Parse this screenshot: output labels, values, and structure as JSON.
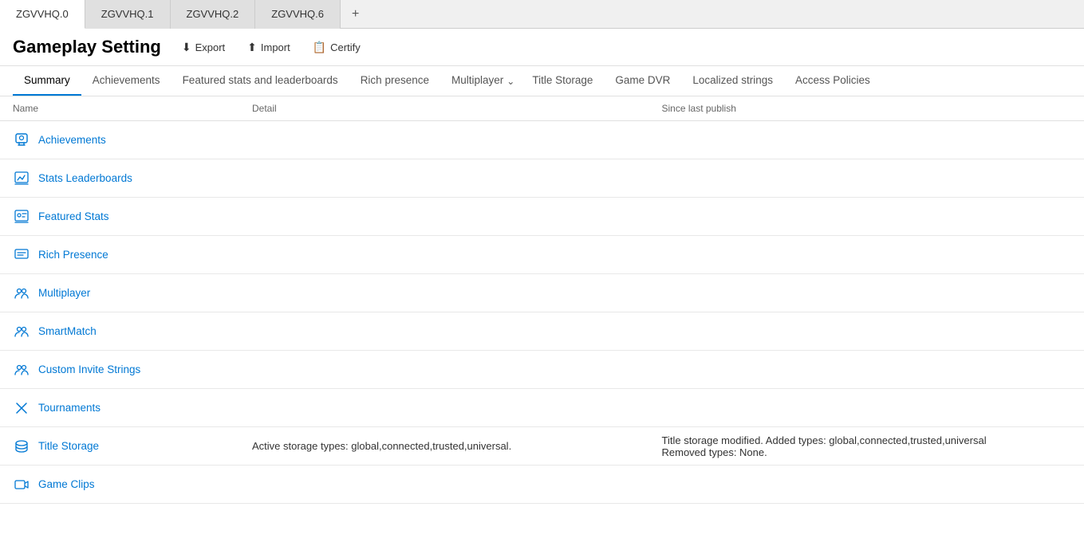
{
  "tabs": [
    {
      "id": "zgvvhq0",
      "label": "ZGVVHQ.0",
      "active": true
    },
    {
      "id": "zgvvhq1",
      "label": "ZGVVHQ.1",
      "active": false
    },
    {
      "id": "zgvvhq2",
      "label": "ZGVVHQ.2",
      "active": false
    },
    {
      "id": "zgvvhq6",
      "label": "ZGVVHQ.6",
      "active": false
    }
  ],
  "tab_add_label": "+",
  "page_title": "Gameplay Setting",
  "actions": [
    {
      "id": "export",
      "icon": "⬇",
      "label": "Export"
    },
    {
      "id": "import",
      "icon": "⬆",
      "label": "Import"
    },
    {
      "id": "certify",
      "icon": "📋",
      "label": "Certify"
    }
  ],
  "nav_tabs": [
    {
      "id": "summary",
      "label": "Summary",
      "active": true
    },
    {
      "id": "achievements",
      "label": "Achievements",
      "active": false
    },
    {
      "id": "featured-stats",
      "label": "Featured stats and leaderboards",
      "active": false
    },
    {
      "id": "rich-presence",
      "label": "Rich presence",
      "active": false
    },
    {
      "id": "multiplayer",
      "label": "Multiplayer",
      "active": false,
      "has_chevron": true
    },
    {
      "id": "title-storage",
      "label": "Title Storage",
      "active": false
    },
    {
      "id": "game-dvr",
      "label": "Game DVR",
      "active": false
    },
    {
      "id": "localized-strings",
      "label": "Localized strings",
      "active": false
    },
    {
      "id": "access-policies",
      "label": "Access Policies",
      "active": false
    }
  ],
  "table": {
    "columns": [
      {
        "id": "name",
        "label": "Name"
      },
      {
        "id": "detail",
        "label": "Detail"
      },
      {
        "id": "since",
        "label": "Since last publish"
      }
    ],
    "rows": [
      {
        "id": "achievements",
        "icon": "achievements",
        "name": "Achievements",
        "detail": "",
        "since": ""
      },
      {
        "id": "stats-leaderboards",
        "icon": "stats",
        "name": "Stats Leaderboards",
        "detail": "",
        "since": ""
      },
      {
        "id": "featured-stats",
        "icon": "featured",
        "name": "Featured Stats",
        "detail": "",
        "since": ""
      },
      {
        "id": "rich-presence",
        "icon": "rich-presence",
        "name": "Rich Presence",
        "detail": "",
        "since": ""
      },
      {
        "id": "multiplayer",
        "icon": "multiplayer",
        "name": "Multiplayer",
        "detail": "",
        "since": ""
      },
      {
        "id": "smartmatch",
        "icon": "smartmatch",
        "name": "SmartMatch",
        "detail": "",
        "since": ""
      },
      {
        "id": "custom-invite",
        "icon": "invite",
        "name": "Custom Invite Strings",
        "detail": "",
        "since": ""
      },
      {
        "id": "tournaments",
        "icon": "tournaments",
        "name": "Tournaments",
        "detail": "",
        "since": ""
      },
      {
        "id": "title-storage",
        "icon": "storage",
        "name": "Title Storage",
        "detail": "Active storage types: global,connected,trusted,universal.",
        "since": "Title storage modified. Added types: global,connected,trusted,universal\nRemoved types: None."
      },
      {
        "id": "game-clips",
        "icon": "clips",
        "name": "Game Clips",
        "detail": "",
        "since": ""
      }
    ]
  },
  "icons": {
    "achievements": "🏆",
    "stats": "📊",
    "featured": "⭐",
    "rich-presence": "💬",
    "multiplayer": "👥",
    "smartmatch": "👥",
    "invite": "👥",
    "tournaments": "✖",
    "storage": "☁",
    "clips": "🎬"
  }
}
